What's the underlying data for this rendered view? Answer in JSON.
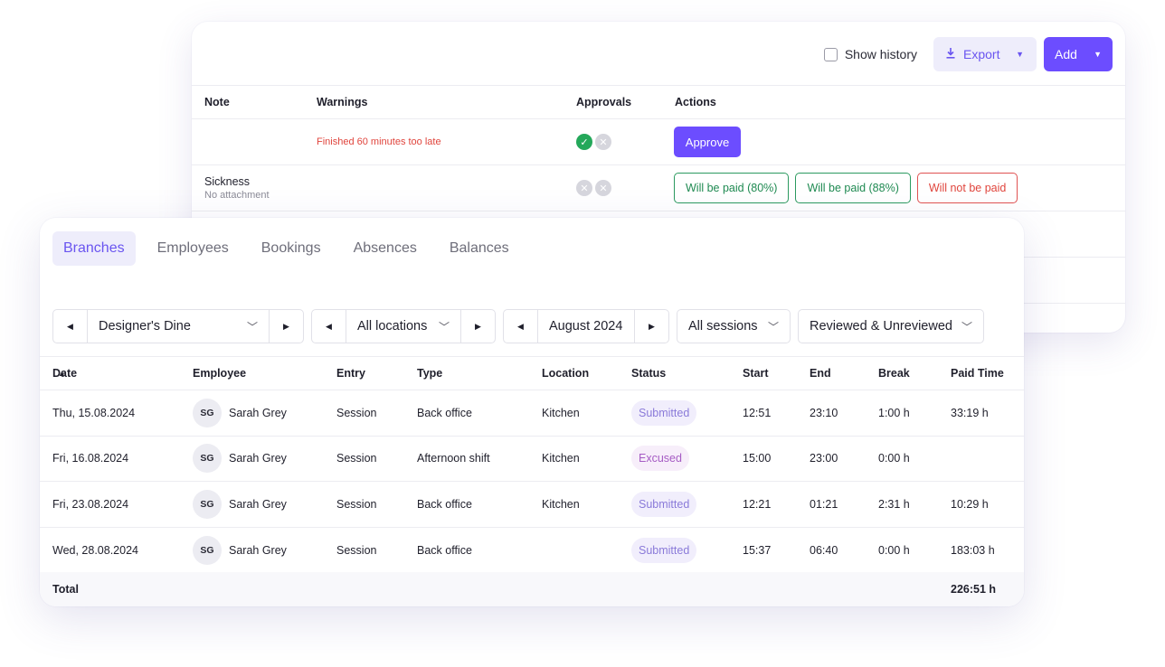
{
  "toolbar": {
    "show_history": "Show history",
    "export_label": "Export",
    "add_label": "Add"
  },
  "approvals_table": {
    "headers": {
      "note": "Note",
      "warnings": "Warnings",
      "approvals": "Approvals",
      "actions": "Actions"
    },
    "rows": [
      {
        "note": "",
        "note_sub": "",
        "warning": "Finished 60 minutes too late",
        "approve": "Approve"
      },
      {
        "note": "Sickness",
        "note_sub": "No attachment",
        "warning": "",
        "paid_80": "Will be paid (80%)",
        "paid_88": "Will be paid (88%)",
        "not_paid": "Will not be paid"
      }
    ]
  },
  "tabs": [
    {
      "label": "Branches",
      "active": true
    },
    {
      "label": "Employees",
      "active": false
    },
    {
      "label": "Bookings",
      "active": false
    },
    {
      "label": "Absences",
      "active": false
    },
    {
      "label": "Balances",
      "active": false
    }
  ],
  "filters": {
    "branch": "Designer's Dine",
    "location": "All locations",
    "month": "August 2024",
    "sessions": "All sessions",
    "review": "Reviewed & Unreviewed"
  },
  "table": {
    "headers": {
      "date": "Date",
      "employee": "Employee",
      "entry": "Entry",
      "type": "Type",
      "location": "Location",
      "status": "Status",
      "start": "Start",
      "end": "End",
      "break": "Break",
      "paid_time": "Paid Time"
    },
    "rows": [
      {
        "date": "Thu, 15.08.2024",
        "initials": "SG",
        "employee": "Sarah Grey",
        "entry": "Session",
        "type": "Back office",
        "location": "Kitchen",
        "status": "Submitted",
        "start": "12:51",
        "end": "23:10",
        "break": "1:00 h",
        "paid": "33:19 h"
      },
      {
        "date": "Fri, 16.08.2024",
        "initials": "SG",
        "employee": "Sarah Grey",
        "entry": "Session",
        "type": "Afternoon shift",
        "location": "Kitchen",
        "status": "Excused",
        "start": "15:00",
        "end": "23:00",
        "break": "0:00 h",
        "paid": ""
      },
      {
        "date": "Fri, 23.08.2024",
        "initials": "SG",
        "employee": "Sarah Grey",
        "entry": "Session",
        "type": "Back office",
        "location": "Kitchen",
        "status": "Submitted",
        "start": "12:21",
        "end": "01:21",
        "break": "2:31 h",
        "paid": "10:29 h"
      },
      {
        "date": "Wed, 28.08.2024",
        "initials": "SG",
        "employee": "Sarah Grey",
        "entry": "Session",
        "type": "Back office",
        "location": "",
        "status": "Submitted",
        "start": "15:37",
        "end": "06:40",
        "break": "0:00 h",
        "paid": "183:03 h"
      }
    ],
    "total_label": "Total",
    "total_value": "226:51 h"
  },
  "colors": {
    "accent": "#6c4dff",
    "accent_soft": "#eeedfb",
    "success": "#24a85a",
    "danger": "#e0453d"
  }
}
